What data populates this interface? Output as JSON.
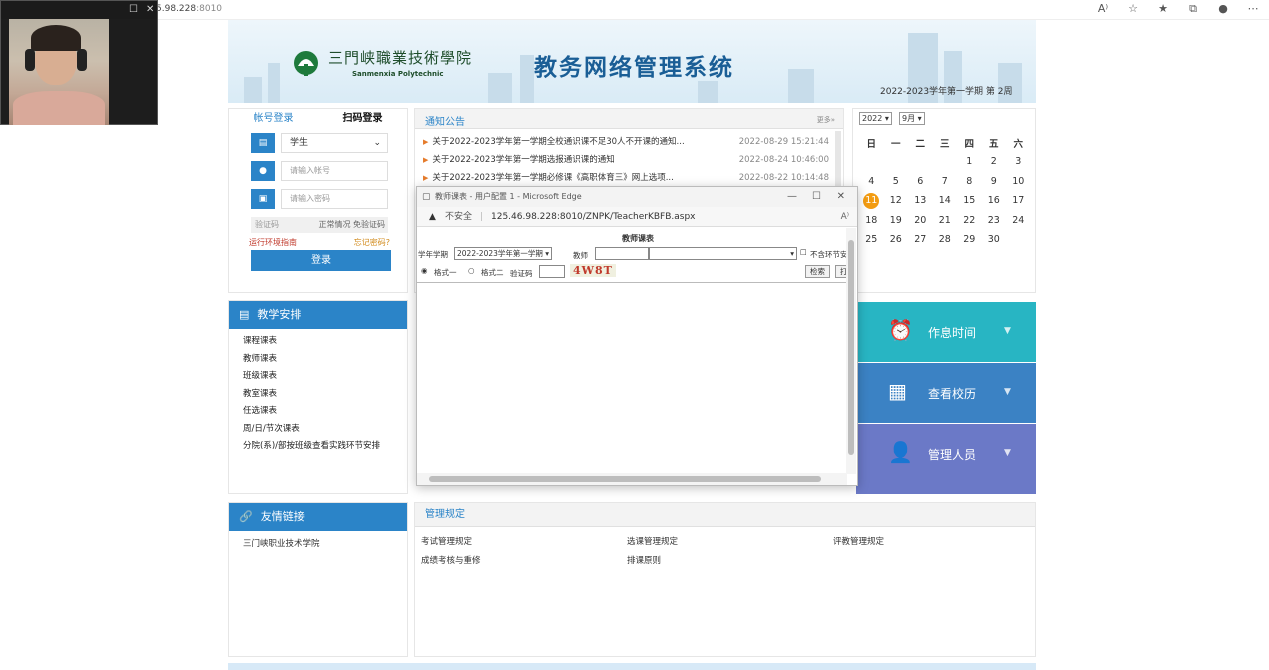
{
  "browser": {
    "address_host": "5.98.228",
    "address_port": ":8010",
    "icons": [
      "read-aloud-icon",
      "favorites-add-icon",
      "favorites-icon",
      "collections-icon",
      "profile-icon",
      "more-icon"
    ]
  },
  "header": {
    "school_cn": "三門峡職業技術學院",
    "school_en": "Sanmenxia Polytechnic",
    "system_title": "教务网络管理系统",
    "term": "2022-2023学年第一学期 第 2周"
  },
  "login": {
    "tab_account": "帐号登录",
    "tab_qr": "扫码登录",
    "role": "学生",
    "account_placeholder": "请输入帐号",
    "password_placeholder": "请输入密码",
    "captcha_placeholder": "验证码",
    "captcha_hint": "正常情况 免验证码",
    "env_guide": "运行环境指南",
    "forgot": "忘记密码?",
    "submit": "登录"
  },
  "notice": {
    "title": "通知公告",
    "more": "更多»",
    "items": [
      {
        "title": "关于2022-2023学年第一学期全校通识课不足30人不开课的通知...",
        "date": "2022-08-29 15:21:44"
      },
      {
        "title": "关于2022-2023学年第一学期选报通识课的通知",
        "date": "2022-08-24 10:46:00"
      },
      {
        "title": "关于2022-2023学年第一学期必修课《高职体育三》网上选项...",
        "date": "2022-08-22 10:14:48"
      }
    ]
  },
  "calendar": {
    "year": "2022",
    "month": "9月",
    "weekdays": [
      "日",
      "一",
      "二",
      "三",
      "四",
      "五",
      "六"
    ],
    "weeks": [
      [
        "",
        "",
        "",
        "",
        "1",
        "2",
        "3"
      ],
      [
        "4",
        "5",
        "6",
        "7",
        "8",
        "9",
        "10"
      ],
      [
        "11",
        "12",
        "13",
        "14",
        "15",
        "16",
        "17"
      ],
      [
        "18",
        "19",
        "20",
        "21",
        "22",
        "23",
        "24"
      ],
      [
        "25",
        "26",
        "27",
        "28",
        "29",
        "30",
        ""
      ]
    ],
    "today": "11"
  },
  "teaching": {
    "title": "教学安排",
    "items": [
      "课程课表",
      "教师课表",
      "班级课表",
      "教室课表",
      "任选课表",
      "周/日/节次课表",
      "分院(系)/部按班级查看实践环节安排"
    ]
  },
  "tiles": [
    {
      "label": "作息时间",
      "icon": "alarm-clock-icon",
      "color": "#28b5c3"
    },
    {
      "label": "查看校历",
      "icon": "calendar-icon",
      "color": "#3b82c4"
    },
    {
      "label": "管理人员",
      "icon": "admin-user-icon",
      "color": "#6b79c7"
    }
  ],
  "links": {
    "title": "友情链接",
    "items": [
      "三门峡职业技术学院"
    ]
  },
  "rules": {
    "title": "管理规定",
    "items": [
      "考试管理规定",
      "选课管理规定",
      "评教管理规定",
      "成绩考核与重修",
      "排课原则"
    ]
  },
  "popup": {
    "window_title": "教师课表 - 用户配置 1 - Microsoft Edge",
    "not_secure": "不安全",
    "url": "125.46.98.228:8010/ZNPK/TeacherKBFB.aspx",
    "heading": "教师课表",
    "term_label": "学年学期",
    "term_value": "2022-2023学年第一学期",
    "teacher_label": "教师",
    "exclude_label": "不含环节安",
    "format1": "格式一",
    "format2": "格式二",
    "captcha_label": "验证码",
    "captcha_text": "4W8T",
    "search_btn": "检索",
    "print_btn": "打"
  }
}
